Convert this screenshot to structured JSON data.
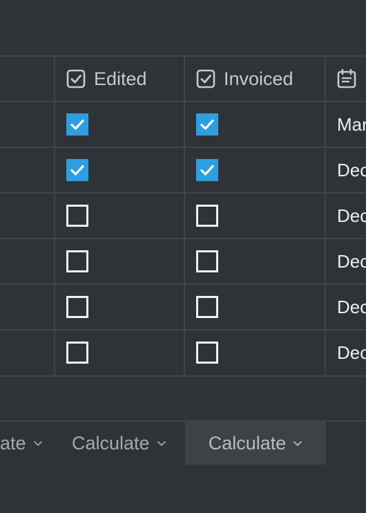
{
  "columns": {
    "edited": {
      "label": "Edited",
      "icon": "checkbox-field-icon"
    },
    "invoiced": {
      "label": "Invoiced",
      "icon": "checkbox-field-icon"
    },
    "date": {
      "label": "",
      "icon": "calendar-icon"
    }
  },
  "rows": [
    {
      "edited": true,
      "invoiced": true,
      "date": "Mar"
    },
    {
      "edited": true,
      "invoiced": true,
      "date": "Dec"
    },
    {
      "edited": false,
      "invoiced": false,
      "date": "Dec"
    },
    {
      "edited": false,
      "invoiced": false,
      "date": "Dec"
    },
    {
      "edited": false,
      "invoiced": false,
      "date": "Dec"
    },
    {
      "edited": false,
      "invoiced": false,
      "date": "Dec"
    }
  ],
  "footer": {
    "calc_left": "ate",
    "calc_edited": "Calculate",
    "calc_invoiced": "Calculate"
  },
  "colors": {
    "background": "#2f3337",
    "checked": "#2d9ee0",
    "grid": "#41464b"
  }
}
